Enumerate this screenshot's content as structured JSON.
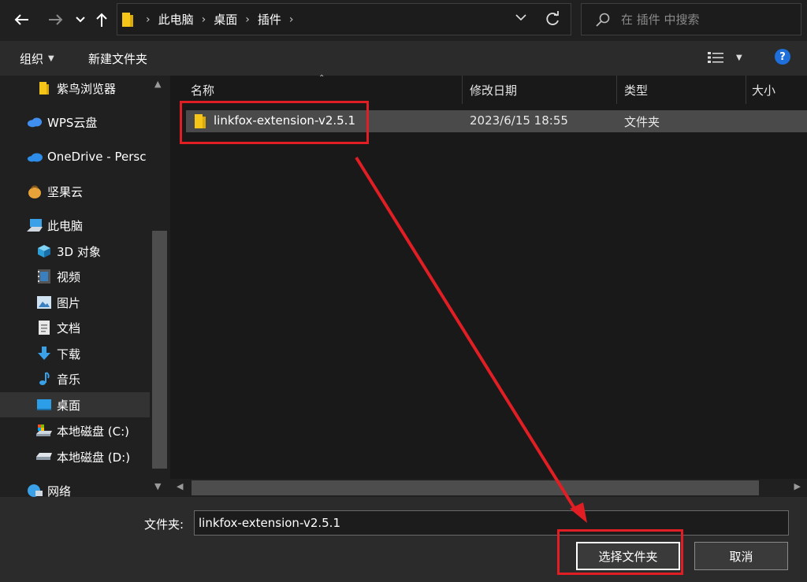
{
  "address": {
    "breadcrumbs": [
      "此电脑",
      "桌面",
      "插件"
    ],
    "search_placeholder": "在 插件 中搜索"
  },
  "toolbar": {
    "organize_label": "组织",
    "new_folder_label": "新建文件夹",
    "help_label": "?"
  },
  "nav_pane": {
    "items": [
      {
        "label": "紫鸟浏览器",
        "icon": "folder-icon"
      },
      {
        "label": "WPS云盘",
        "icon": "cloud-icon"
      },
      {
        "label": "OneDrive - Persc",
        "icon": "onedrive-icon"
      },
      {
        "label": "坚果云",
        "icon": "nut-icon"
      },
      {
        "label": "此电脑",
        "icon": "computer-icon"
      },
      {
        "label": "3D 对象",
        "icon": "cube-icon"
      },
      {
        "label": "视频",
        "icon": "video-icon"
      },
      {
        "label": "图片",
        "icon": "picture-icon"
      },
      {
        "label": "文档",
        "icon": "document-icon"
      },
      {
        "label": "下载",
        "icon": "download-icon"
      },
      {
        "label": "音乐",
        "icon": "music-icon"
      },
      {
        "label": "桌面",
        "icon": "desktop-icon",
        "selected": true
      },
      {
        "label": "本地磁盘 (C:)",
        "icon": "drive-c-icon"
      },
      {
        "label": "本地磁盘 (D:)",
        "icon": "drive-d-icon"
      },
      {
        "label": "网络",
        "icon": "network-icon"
      }
    ]
  },
  "file_list": {
    "columns": [
      "名称",
      "修改日期",
      "类型",
      "大小"
    ],
    "rows": [
      {
        "name": "linkfox-extension-v2.5.1",
        "date": "2023/6/15 18:55",
        "type": "文件夹"
      }
    ]
  },
  "bottom": {
    "folder_label": "文件夹:",
    "folder_value": "linkfox-extension-v2.5.1",
    "select_button": "选择文件夹",
    "cancel_button": "取消"
  },
  "colors": {
    "background": "#202020",
    "annotation_red": "#e01e24",
    "folder_yellow": "#f5c518",
    "selection": "#4a4a4a",
    "accent_blue": "#1e6fd9"
  }
}
